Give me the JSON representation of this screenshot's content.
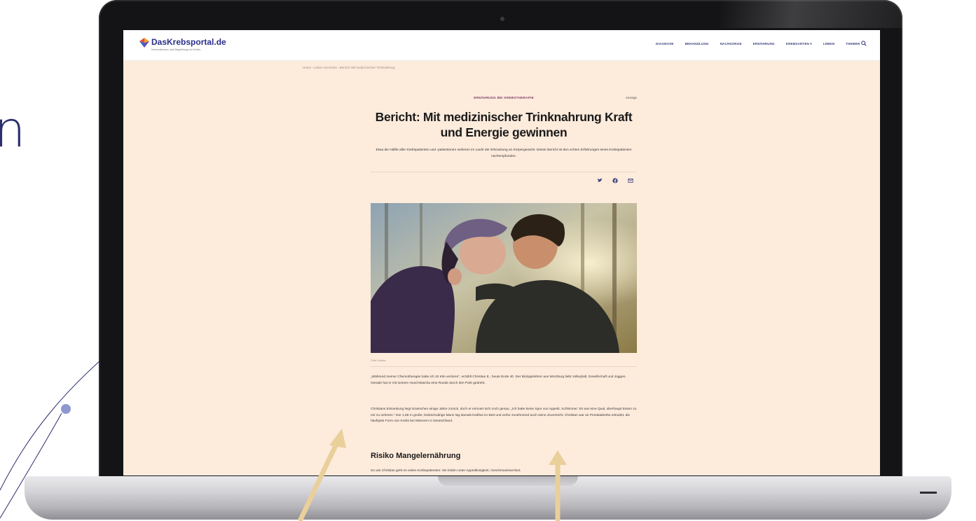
{
  "background": {
    "letter": "n",
    "accent_color": "#2b2f6b"
  },
  "site": {
    "logo_text": "DasKrebsportal.de",
    "logo_tagline": "Informationen und Begleitung bei Krebs",
    "nav": [
      "DIAGNOSE",
      "BEHANDLUNG",
      "NACHSORGE",
      "ERNÄHRUNG",
      "KREBSARTEN ▾",
      "LEBEN",
      "THEMEN"
    ],
    "search_icon": "search-icon",
    "brand_color": "#2b2f8a"
  },
  "breadcrumb": "Home › Leben mit Krebs › Bericht: Mit medizinischer Trinknahrung",
  "article": {
    "category": "ERNÄHRUNG BEI KREBSTHERAPIE",
    "badge": "Anzeige",
    "headline": "Bericht: Mit medizinischer Trinknahrung Kraft und Energie gewinnen",
    "lead": "Etwa die Hälfte aller Krebspatienten und -patientinnen verlieren im Laufe der Erkrankung an Körpergewicht. Dieser Bericht ist den echten Erfahrungen eines Krebspatienten nachempfunden.",
    "share_icons": [
      "twitter-icon",
      "facebook-icon",
      "mail-icon"
    ],
    "caption": "Foto: Adobe",
    "paragraph1": "„Während meiner Chemotherapie habe ich 10 Kilo verloren“, erzählt Christian E., heute Ende 40. Der Biologielehrer aus Würzburg liebt Volleyball, Gesellschaft und Joggen. Gerade hat er mit seinem Hund Mascha eine Runde durch den Park gedreht.",
    "paragraph2": "Christians Erkrankung liegt inzwischen einige Jahre zurück, doch er erinnert sich noch genau: „Ich hatte keine Spur von Appetit. Schlimmer: Es war eine Qual, überhaupt Essen zu mir zu nehmen.“ Der 1,88 m große, breitschultrige Mann lag damals kraftlos im Bett und verlor zunehmend auch seine Zuversicht. Christian war an Prostatakrebs erkrankt, die häufigste Form von Krebs bei Männern in Deutschland.",
    "subhead": "Risiko Mangelernährung",
    "paragraph3": "So wie Christian geht es vielen Krebspatienten: Sie leiden unter Appetitlosigkeit, Geschmacksverlust,"
  }
}
